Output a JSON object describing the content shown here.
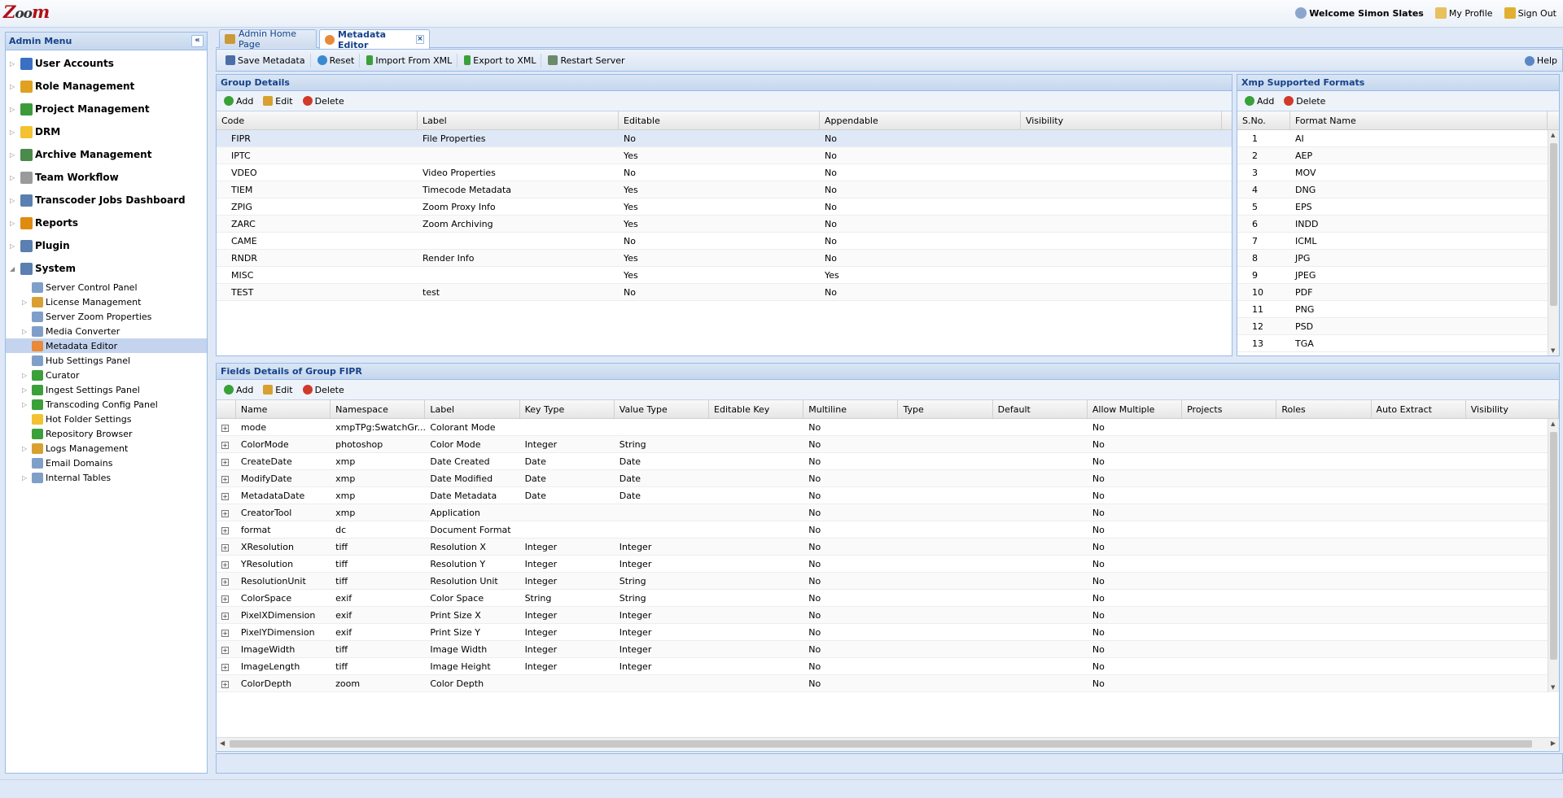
{
  "app": {
    "logo": "Zoom"
  },
  "top": {
    "welcome": "Welcome Simon Slates",
    "profile": "My Profile",
    "signout": "Sign Out"
  },
  "sidebar": {
    "title": "Admin Menu",
    "items": [
      {
        "label": "User Accounts",
        "icon": "users-icon",
        "color": "#3a6fc4"
      },
      {
        "label": "Role Management",
        "icon": "shield-icon",
        "color": "#e0a020"
      },
      {
        "label": "Project Management",
        "icon": "globe-icon",
        "color": "#3b9b3b"
      },
      {
        "label": "DRM",
        "icon": "folder-icon",
        "color": "#f2c230"
      },
      {
        "label": "Archive Management",
        "icon": "archive-icon",
        "color": "#4a8a4a"
      },
      {
        "label": "Team Workflow",
        "icon": "workflow-icon",
        "color": "#9a9a9a"
      },
      {
        "label": "Transcoder Jobs Dashboard",
        "icon": "monitor-icon",
        "color": "#5a7fb0"
      },
      {
        "label": "Reports",
        "icon": "report-icon",
        "color": "#e08a10"
      },
      {
        "label": "Plugin",
        "icon": "plugin-icon",
        "color": "#5a7fb0"
      },
      {
        "label": "System",
        "icon": "system-icon",
        "color": "#5a7fb0"
      }
    ],
    "system_children": [
      {
        "label": "Server Control Panel",
        "icon": "monitor-icon",
        "arrow": false
      },
      {
        "label": "License Management",
        "icon": "license-icon",
        "arrow": true
      },
      {
        "label": "Server Zoom Properties",
        "icon": "properties-icon",
        "arrow": false
      },
      {
        "label": "Media Converter",
        "icon": "converter-icon",
        "arrow": true
      },
      {
        "label": "Metadata Editor",
        "icon": "metadata-icon",
        "arrow": false
      },
      {
        "label": "Hub Settings Panel",
        "icon": "hub-icon",
        "arrow": false
      },
      {
        "label": "Curator",
        "icon": "curator-icon",
        "arrow": true
      },
      {
        "label": "Ingest Settings Panel",
        "icon": "ingest-icon",
        "arrow": true
      },
      {
        "label": "Transcoding Config Panel",
        "icon": "transcode-icon",
        "arrow": true
      },
      {
        "label": "Hot Folder Settings",
        "icon": "folder-icon",
        "arrow": false
      },
      {
        "label": "Repository Browser",
        "icon": "repository-icon",
        "arrow": false
      },
      {
        "label": "Logs Management",
        "icon": "logs-icon",
        "arrow": true
      },
      {
        "label": "Email Domains",
        "icon": "email-icon",
        "arrow": false
      },
      {
        "label": "Internal Tables",
        "icon": "table-icon",
        "arrow": true
      }
    ]
  },
  "tabs": [
    {
      "label": "Admin Home Page"
    },
    {
      "label": "Metadata Editor"
    }
  ],
  "toolbar": {
    "save": "Save Metadata",
    "reset": "Reset",
    "import": "Import From XML",
    "export": "Export to XML",
    "restart": "Restart Server",
    "help": "Help"
  },
  "group_details": {
    "title": "Group Details",
    "add": "Add",
    "edit": "Edit",
    "delete": "Delete",
    "columns": [
      "Code",
      "Label",
      "Editable",
      "Appendable",
      "Visibility"
    ],
    "rows": [
      [
        "FIPR",
        "File Properties",
        "No",
        "No",
        ""
      ],
      [
        "IPTC",
        "",
        "Yes",
        "No",
        ""
      ],
      [
        "VDEO",
        "Video Properties",
        "No",
        "No",
        ""
      ],
      [
        "TIEM",
        "Timecode Metadata",
        "Yes",
        "No",
        ""
      ],
      [
        "ZPIG",
        "Zoom Proxy Info",
        "Yes",
        "No",
        ""
      ],
      [
        "ZARC",
        "Zoom Archiving",
        "Yes",
        "No",
        ""
      ],
      [
        "CAME",
        "",
        "No",
        "No",
        ""
      ],
      [
        "RNDR",
        "Render Info",
        "Yes",
        "No",
        ""
      ],
      [
        "MISC",
        "",
        "Yes",
        "Yes",
        ""
      ],
      [
        "TEST",
        "test",
        "No",
        "No",
        ""
      ]
    ]
  },
  "xmp_formats": {
    "title": "Xmp Supported Formats",
    "add": "Add",
    "delete": "Delete",
    "columns": [
      "S.No.",
      "Format Name"
    ],
    "rows": [
      [
        "1",
        "AI"
      ],
      [
        "2",
        "AEP"
      ],
      [
        "3",
        "MOV"
      ],
      [
        "4",
        "DNG"
      ],
      [
        "5",
        "EPS"
      ],
      [
        "6",
        "INDD"
      ],
      [
        "7",
        "ICML"
      ],
      [
        "8",
        "JPG"
      ],
      [
        "9",
        "JPEG"
      ],
      [
        "10",
        "PDF"
      ],
      [
        "11",
        "PNG"
      ],
      [
        "12",
        "PSD"
      ],
      [
        "13",
        "TGA"
      ]
    ]
  },
  "fields": {
    "title": "Fields Details of Group FIPR",
    "add": "Add",
    "edit": "Edit",
    "delete": "Delete",
    "columns": [
      "Name",
      "Namespace",
      "Label",
      "Key Type",
      "Value Type",
      "Editable Key",
      "Multiline",
      "Type",
      "Default",
      "Allow Multiple",
      "Projects",
      "Roles",
      "Auto Extract",
      "Visibility"
    ],
    "rows": [
      [
        "mode",
        "xmpTPg:SwatchGr...",
        "Colorant Mode",
        "",
        "",
        "",
        "No",
        "",
        "",
        "No",
        "",
        "",
        "",
        ""
      ],
      [
        "ColorMode",
        "photoshop",
        "Color Mode",
        "Integer",
        "String",
        "",
        "No",
        "",
        "",
        "No",
        "",
        "",
        "",
        ""
      ],
      [
        "CreateDate",
        "xmp",
        "Date Created",
        "Date",
        "Date",
        "",
        "No",
        "",
        "",
        "No",
        "",
        "",
        "",
        ""
      ],
      [
        "ModifyDate",
        "xmp",
        "Date Modified",
        "Date",
        "Date",
        "",
        "No",
        "",
        "",
        "No",
        "",
        "",
        "",
        ""
      ],
      [
        "MetadataDate",
        "xmp",
        "Date Metadata",
        "Date",
        "Date",
        "",
        "No",
        "",
        "",
        "No",
        "",
        "",
        "",
        ""
      ],
      [
        "CreatorTool",
        "xmp",
        "Application",
        "",
        "",
        "",
        "No",
        "",
        "",
        "No",
        "",
        "",
        "",
        ""
      ],
      [
        "format",
        "dc",
        "Document Format",
        "",
        "",
        "",
        "No",
        "",
        "",
        "No",
        "",
        "",
        "",
        ""
      ],
      [
        "XResolution",
        "tiff",
        "Resolution X",
        "Integer",
        "Integer",
        "",
        "No",
        "",
        "",
        "No",
        "",
        "",
        "",
        ""
      ],
      [
        "YResolution",
        "tiff",
        "Resolution Y",
        "Integer",
        "Integer",
        "",
        "No",
        "",
        "",
        "No",
        "",
        "",
        "",
        ""
      ],
      [
        "ResolutionUnit",
        "tiff",
        "Resolution Unit",
        "Integer",
        "String",
        "",
        "No",
        "",
        "",
        "No",
        "",
        "",
        "",
        ""
      ],
      [
        "ColorSpace",
        "exif",
        "Color Space",
        "String",
        "String",
        "",
        "No",
        "",
        "",
        "No",
        "",
        "",
        "",
        ""
      ],
      [
        "PixelXDimension",
        "exif",
        "Print Size X",
        "Integer",
        "Integer",
        "",
        "No",
        "",
        "",
        "No",
        "",
        "",
        "",
        ""
      ],
      [
        "PixelYDimension",
        "exif",
        "Print Size Y",
        "Integer",
        "Integer",
        "",
        "No",
        "",
        "",
        "No",
        "",
        "",
        "",
        ""
      ],
      [
        "ImageWidth",
        "tiff",
        "Image Width",
        "Integer",
        "Integer",
        "",
        "No",
        "",
        "",
        "No",
        "",
        "",
        "",
        ""
      ],
      [
        "ImageLength",
        "tiff",
        "Image Height",
        "Integer",
        "Integer",
        "",
        "No",
        "",
        "",
        "No",
        "",
        "",
        "",
        ""
      ],
      [
        "ColorDepth",
        "zoom",
        "Color Depth",
        "",
        "",
        "",
        "No",
        "",
        "",
        "No",
        "",
        "",
        "",
        ""
      ]
    ]
  }
}
